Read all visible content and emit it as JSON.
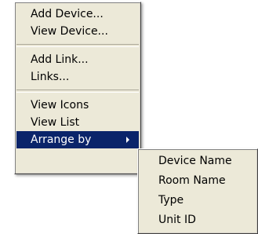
{
  "context_menu": {
    "group1": [
      "Add Device...",
      "View Device..."
    ],
    "group2": [
      "Add Link...",
      "Links..."
    ],
    "group3": [
      "View Icons",
      "View List"
    ],
    "arrange_by_label": "Arrange by"
  },
  "arrange_submenu": {
    "items": [
      "Device Name",
      "Room Name",
      "Type",
      "Unit ID"
    ]
  },
  "colors": {
    "menu_bg": "#ece9d8",
    "highlight": "#0a246a",
    "highlight_text": "#ffffff"
  },
  "icons": {
    "submenu_arrow": "chevron-right-icon"
  }
}
